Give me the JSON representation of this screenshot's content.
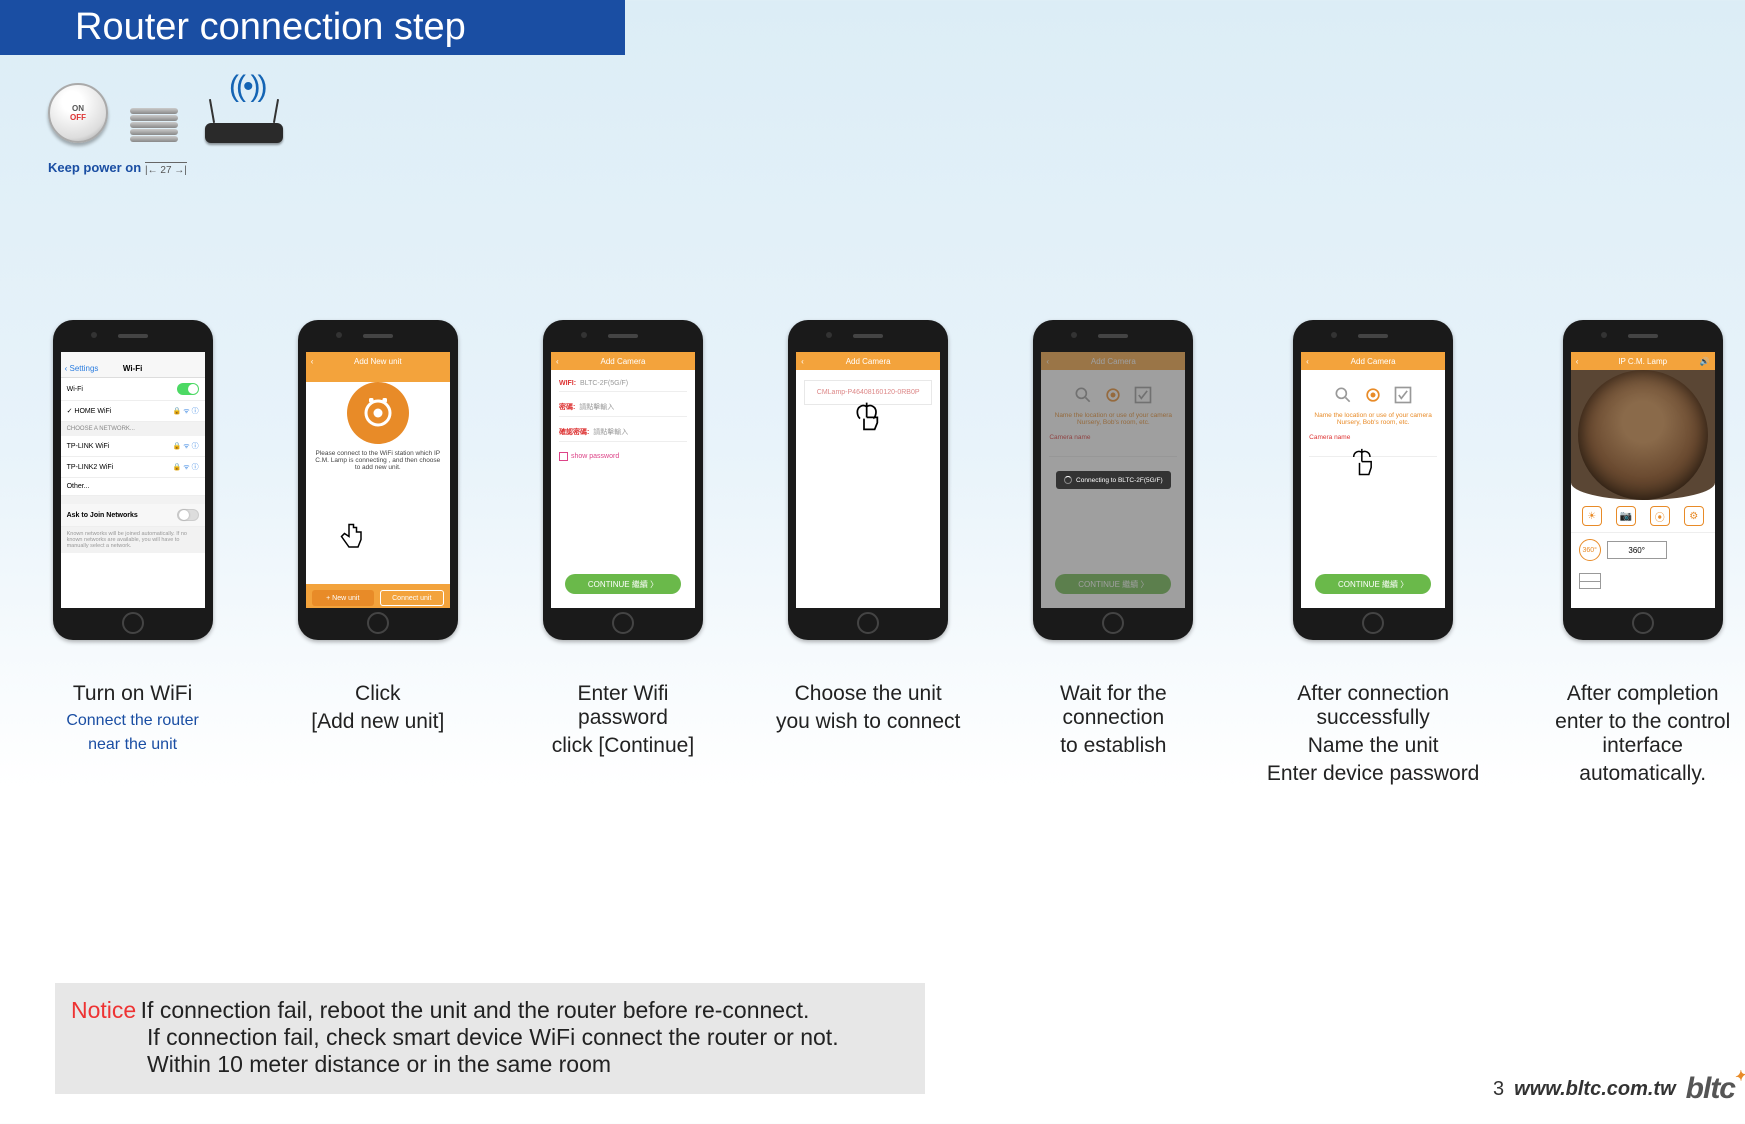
{
  "title": "Router connection step",
  "top": {
    "on": "ON",
    "off": "OFF",
    "keep_power": "Keep power on",
    "dim": "27"
  },
  "steps": [
    {
      "caption_l1": "Turn on WiFi",
      "caption_blue1": "Connect the router",
      "caption_blue2": "near the unit",
      "screen": {
        "nav_back": "Settings",
        "nav_title": "Wi-Fi",
        "wifi_label": "Wi-Fi",
        "connected": "HOME WiFi",
        "choose": "CHOOSE A NETWORK...",
        "net1": "TP-LINK WiFi",
        "net2": "TP-LINK2 WiFi",
        "other": "Other...",
        "ask_join": "Ask to Join Networks",
        "ask_note": "Known networks will be joined automatically. If no known networks are available, you will have to manually select a network."
      }
    },
    {
      "caption_l1": "Click",
      "caption_l2": "[Add new unit]",
      "screen": {
        "title": "Add New unit",
        "instr": "Please connect to the WiFi station which IP C.M. Lamp is connecting , and then choose to add new unit.",
        "btn_new": "+ New unit",
        "btn_connect": "Connect unit"
      }
    },
    {
      "caption_l1": "Enter Wifi password",
      "caption_l2": "click  [Continue]",
      "screen": {
        "title": "Add Camera",
        "wifi_lbl": "WIFI:",
        "wifi_val": "BLTC-2F(5G/F)",
        "pwd_lbl": "密碼:",
        "pwd_hint": "請點擊輸入",
        "confirm_lbl": "確認密碼:",
        "confirm_hint": "請點擊輸入",
        "show_pwd": "show password",
        "continue": "CONTINUE 繼續  〉"
      }
    },
    {
      "caption_l1": "Choose the unit",
      "caption_l2": "you wish to connect",
      "screen": {
        "title": "Add Camera",
        "unit": "CMLamp-P46408160120-0RB0P"
      }
    },
    {
      "caption_l1": "Wait for the connection",
      "caption_l2": "to establish",
      "screen": {
        "title": "Add Camera",
        "hint": "Name the location or use of your camera Nursery, Bob's room, etc.",
        "name_lbl": "Camera name",
        "connecting": "Connecting to BLTC-2F(5G/F)",
        "continue": "CONTINUE 繼續  〉"
      }
    },
    {
      "caption_l1": "After connection successfully",
      "caption_l2": "Name the unit",
      "caption_l3": "Enter device password",
      "screen": {
        "title": "Add Camera",
        "hint": "Name the location or use of your camera Nursery, Bob's room, etc.",
        "name_lbl": "Camera name",
        "continue": "CONTINUE 繼續  〉"
      }
    },
    {
      "caption_l1": "After completion",
      "caption_l2": "enter to the control interface",
      "caption_l3": "automatically.",
      "screen": {
        "title": "IP C.M. Lamp",
        "v360": "360°"
      }
    }
  ],
  "notice": {
    "label": "Notice",
    "l1": "If connection fail, reboot the unit and the router before re-connect.",
    "l2": "If connection fail, check smart device WiFi connect  the router or not.",
    "l3": "Within 10 meter distance or in the same room"
  },
  "footer": {
    "page": "3",
    "url": "www.bltc.com.tw",
    "logo": "bltc"
  }
}
